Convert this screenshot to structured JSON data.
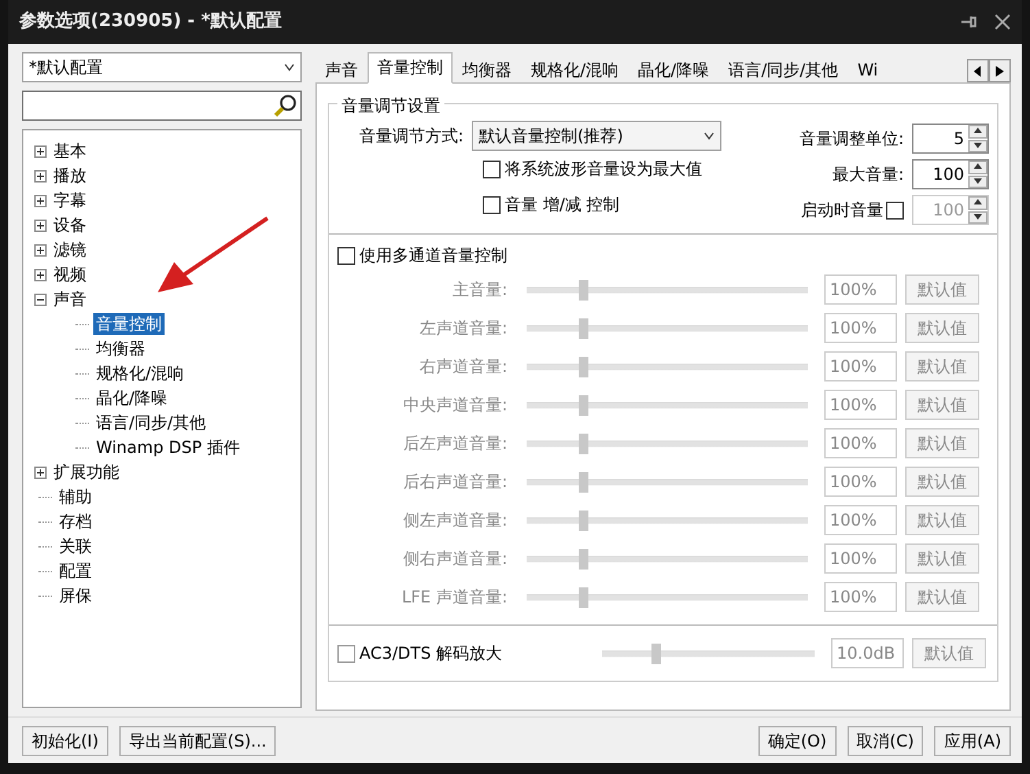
{
  "window": {
    "title": "参数选项(230905) - *默认配置"
  },
  "profile_select": {
    "value": "*默认配置"
  },
  "tree": [
    {
      "label": "基本",
      "kind": "group",
      "expanded": false,
      "selected": false
    },
    {
      "label": "播放",
      "kind": "group",
      "expanded": false,
      "selected": false
    },
    {
      "label": "字幕",
      "kind": "group",
      "expanded": false,
      "selected": false
    },
    {
      "label": "设备",
      "kind": "group",
      "expanded": false,
      "selected": false
    },
    {
      "label": "滤镜",
      "kind": "group",
      "expanded": false,
      "selected": false
    },
    {
      "label": "视频",
      "kind": "group",
      "expanded": false,
      "selected": false
    },
    {
      "label": "声音",
      "kind": "group",
      "expanded": true,
      "selected": false,
      "children": [
        {
          "label": "音量控制",
          "kind": "leaf",
          "selected": true
        },
        {
          "label": "均衡器",
          "kind": "leaf",
          "selected": false
        },
        {
          "label": "规格化/混响",
          "kind": "leaf",
          "selected": false
        },
        {
          "label": "晶化/降噪",
          "kind": "leaf",
          "selected": false
        },
        {
          "label": "语言/同步/其他",
          "kind": "leaf",
          "selected": false
        },
        {
          "label": "Winamp DSP 插件",
          "kind": "leaf",
          "selected": false
        }
      ]
    },
    {
      "label": "扩展功能",
      "kind": "group",
      "expanded": false,
      "selected": false
    },
    {
      "label": "辅助",
      "kind": "leaf",
      "selected": false
    },
    {
      "label": "存档",
      "kind": "leaf",
      "selected": false
    },
    {
      "label": "关联",
      "kind": "leaf",
      "selected": false
    },
    {
      "label": "配置",
      "kind": "leaf",
      "selected": false
    },
    {
      "label": "屏保",
      "kind": "leaf",
      "selected": false
    }
  ],
  "tabs": [
    {
      "label": "声音",
      "selected": false
    },
    {
      "label": "音量控制",
      "selected": true
    },
    {
      "label": "均衡器",
      "selected": false
    },
    {
      "label": "规格化/混响",
      "selected": false
    },
    {
      "label": "晶化/降噪",
      "selected": false
    },
    {
      "label": "语言/同步/其他",
      "selected": false
    },
    {
      "label": "Wi",
      "selected": false
    }
  ],
  "volume_group": {
    "title": "音量调节设置",
    "mode_label": "音量调节方式:",
    "mode_value": "默认音量控制(推荐)",
    "checkboxes": [
      {
        "label": "将系统波形音量设为最大值",
        "checked": false
      },
      {
        "label": "音量 增/减 控制",
        "checked": false
      }
    ],
    "spinners": [
      {
        "label": "音量调整单位:",
        "kind": "plain",
        "value": "5",
        "disabled": false
      },
      {
        "label": "最大音量:",
        "kind": "plain",
        "value": "100",
        "disabled": false
      },
      {
        "label": "启动时音量",
        "kind": "checkbox",
        "checked": false,
        "value": "100",
        "disabled": true
      }
    ]
  },
  "multichannel": {
    "label": "使用多通道音量控制",
    "checked": false,
    "disabled": true,
    "channels": [
      {
        "name": "主音量:",
        "level": 0.2,
        "value": "100%",
        "button": "默认值"
      },
      {
        "name": "左声道音量:",
        "level": 0.2,
        "value": "100%",
        "button": "默认值"
      },
      {
        "name": "右声道音量:",
        "level": 0.2,
        "value": "100%",
        "button": "默认值"
      },
      {
        "name": "中央声道音量:",
        "level": 0.2,
        "value": "100%",
        "button": "默认值"
      },
      {
        "name": "后左声道音量:",
        "level": 0.2,
        "value": "100%",
        "button": "默认值"
      },
      {
        "name": "后右声道音量:",
        "level": 0.2,
        "value": "100%",
        "button": "默认值"
      },
      {
        "name": "侧左声道音量:",
        "level": 0.2,
        "value": "100%",
        "button": "默认值"
      },
      {
        "name": "侧右声道音量:",
        "level": 0.2,
        "value": "100%",
        "button": "默认值"
      },
      {
        "name": "LFE 声道音量:",
        "level": 0.2,
        "value": "100%",
        "button": "默认值"
      }
    ]
  },
  "ac3": {
    "label": "AC3/DTS 解码放大",
    "checked": false,
    "disabled": true,
    "level": 0.25,
    "value": "10.0dB",
    "button": "默认值"
  },
  "footer_left": [
    "初始化(I)",
    "导出当前配置(S)..."
  ],
  "footer_right": [
    "确定(O)",
    "取消(C)",
    "应用(A)"
  ]
}
